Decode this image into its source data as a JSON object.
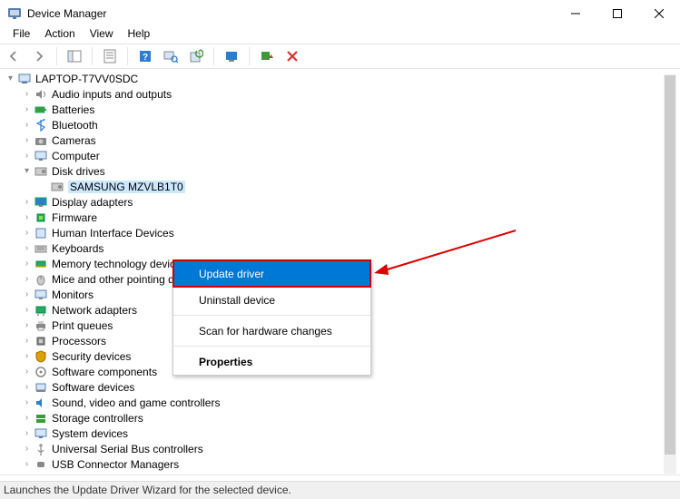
{
  "titlebar": {
    "title": "Device Manager"
  },
  "menu": {
    "file": "File",
    "action": "Action",
    "view": "View",
    "help": "Help"
  },
  "tree": {
    "root": "LAPTOP-T7VV0SDC",
    "items": [
      "Audio inputs and outputs",
      "Batteries",
      "Bluetooth",
      "Cameras",
      "Computer",
      "Disk drives",
      "Display adapters",
      "Firmware",
      "Human Interface Devices",
      "Keyboards",
      "Memory technology devices",
      "Mice and other pointing devices",
      "Monitors",
      "Network adapters",
      "Print queues",
      "Processors",
      "Security devices",
      "Software components",
      "Software devices",
      "Sound, video and game controllers",
      "Storage controllers",
      "System devices",
      "Universal Serial Bus controllers",
      "USB Connector Managers"
    ],
    "disk_child": "SAMSUNG MZVLB1T0"
  },
  "context_menu": {
    "update": "Update driver",
    "uninstall": "Uninstall device",
    "scan": "Scan for hardware changes",
    "properties": "Properties"
  },
  "statusbar": {
    "text": "Launches the Update Driver Wizard for the selected device."
  }
}
